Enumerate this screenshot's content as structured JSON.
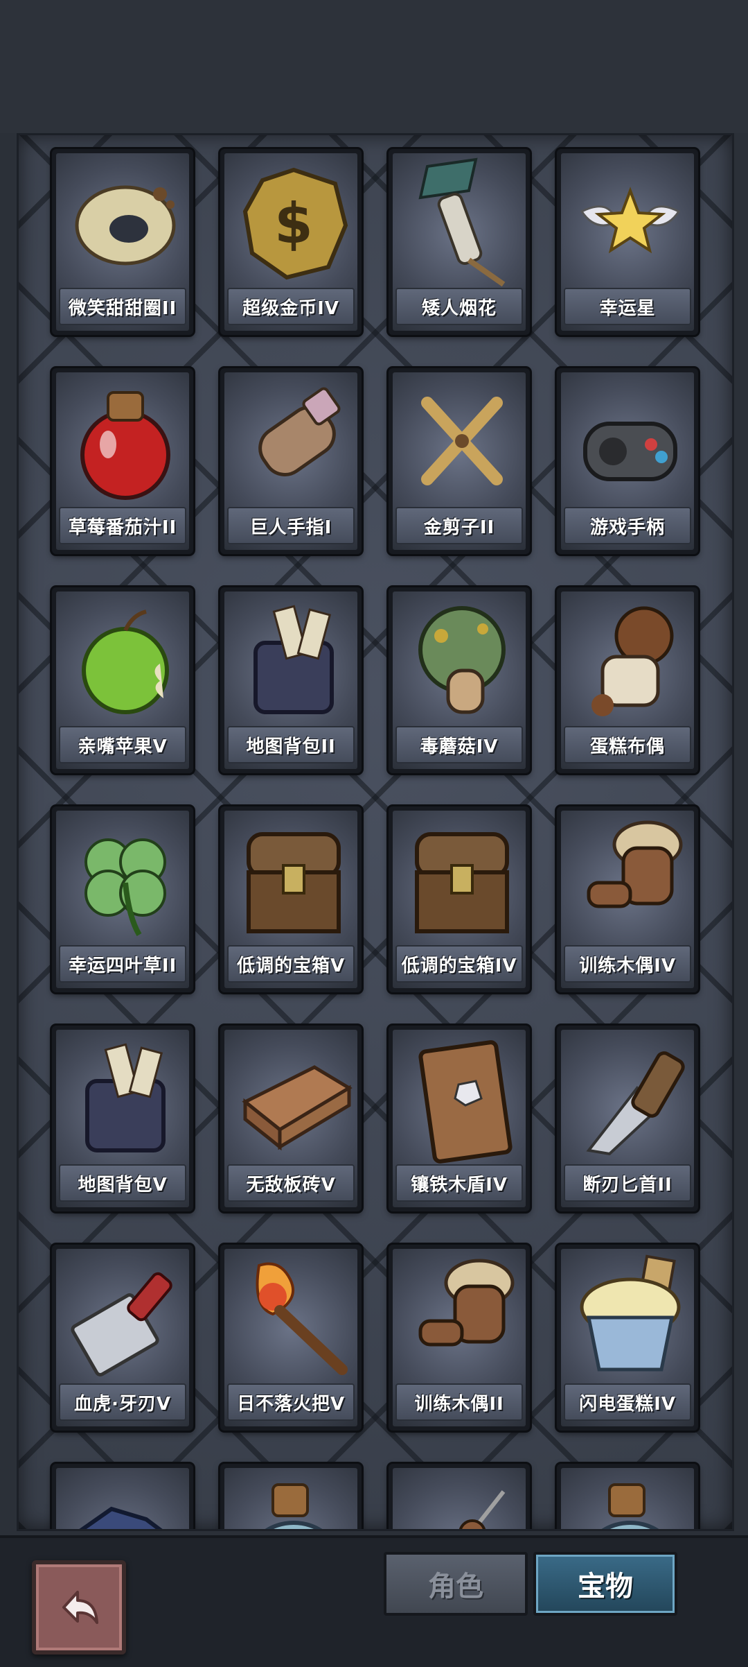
{
  "items": [
    {
      "label": "微笑甜甜圈II",
      "icon": "donut-icon"
    },
    {
      "label": "超级金币IV",
      "icon": "gold-coin-icon"
    },
    {
      "label": "矮人烟花",
      "icon": "firework-icon"
    },
    {
      "label": "幸运星",
      "icon": "winged-star-icon"
    },
    {
      "label": "草莓番茄汁II",
      "icon": "juice-bottle-icon"
    },
    {
      "label": "巨人手指I",
      "icon": "giant-finger-icon"
    },
    {
      "label": "金剪子II",
      "icon": "scissors-icon"
    },
    {
      "label": "游戏手柄",
      "icon": "gamepad-icon"
    },
    {
      "label": "亲嘴苹果V",
      "icon": "apple-icon"
    },
    {
      "label": "地图背包II",
      "icon": "map-bag-icon"
    },
    {
      "label": "毒蘑菇IV",
      "icon": "mushroom-icon"
    },
    {
      "label": "蛋糕布偶",
      "icon": "doll-icon"
    },
    {
      "label": "幸运四叶草II",
      "icon": "clover-icon"
    },
    {
      "label": "低调的宝箱V",
      "icon": "chest-icon"
    },
    {
      "label": "低调的宝箱IV",
      "icon": "chest-icon"
    },
    {
      "label": "训练木偶IV",
      "icon": "training-dummy-icon"
    },
    {
      "label": "地图背包V",
      "icon": "map-bag-icon"
    },
    {
      "label": "无敌板砖V",
      "icon": "brick-icon"
    },
    {
      "label": "镶铁木盾IV",
      "icon": "wooden-shield-icon"
    },
    {
      "label": "断刃匕首II",
      "icon": "broken-dagger-icon"
    },
    {
      "label": "血虎·牙刃V",
      "icon": "cleaver-icon"
    },
    {
      "label": "日不落火把V",
      "icon": "torch-icon"
    },
    {
      "label": "训练木偶II",
      "icon": "training-dummy-icon"
    },
    {
      "label": "闪电蛋糕IV",
      "icon": "cupcake-icon"
    },
    {
      "label": "",
      "icon": "ore-icon"
    },
    {
      "label": "",
      "icon": "potion-bottle-icon"
    },
    {
      "label": "",
      "icon": "skewer-icon"
    },
    {
      "label": "",
      "icon": "potion-bottle-icon"
    }
  ],
  "tabs": {
    "role": "角色",
    "treasure": "宝物",
    "active": "treasure"
  },
  "back_button": {
    "icon": "back-arrow-icon"
  },
  "colors": {
    "background": "#2b3038",
    "panel": "#3b414d",
    "card_label": "#ffffff",
    "active_tab": "#2e5a74"
  }
}
